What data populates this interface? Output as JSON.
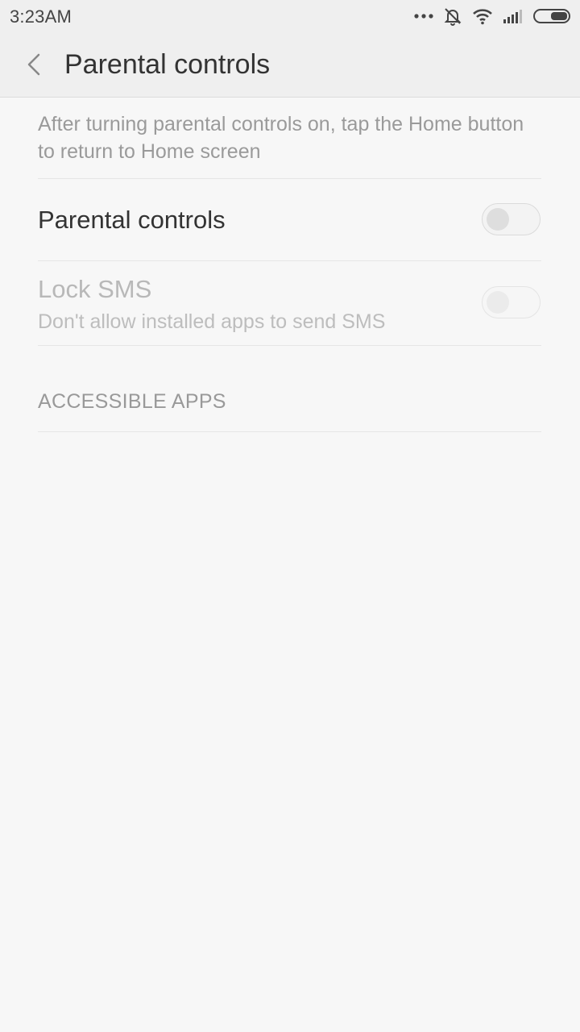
{
  "status_bar": {
    "time": "3:23AM",
    "icons": [
      "more-dots-icon",
      "mute-bell-icon",
      "wifi-icon",
      "signal-icon",
      "battery-icon"
    ]
  },
  "header": {
    "back_icon": "chevron-left-icon",
    "title": "Parental controls"
  },
  "main": {
    "description": "After turning parental controls on, tap the Home button to return to Home screen",
    "settings": [
      {
        "title": "Parental controls",
        "subtitle": "",
        "enabled": true,
        "checked": false
      },
      {
        "title": "Lock SMS",
        "subtitle": "Don't allow installed apps to send SMS",
        "enabled": false,
        "checked": false
      }
    ],
    "section_header": "ACCESSIBLE APPS"
  },
  "colors": {
    "background": "#f7f7f7",
    "header_background": "#efefef",
    "primary_text": "#333333",
    "secondary_text": "#9a9a9a",
    "disabled_text": "#b8b8b8"
  }
}
